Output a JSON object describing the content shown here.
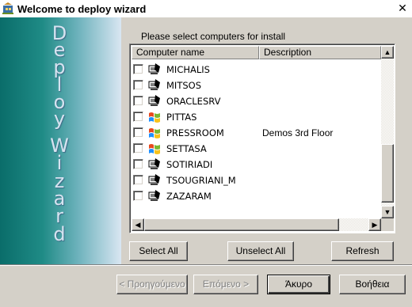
{
  "window": {
    "title": "Welcome to deploy wizard",
    "close_glyph": "✕"
  },
  "banner": {
    "letters": [
      "D",
      "e",
      "p",
      "l",
      "o",
      "y",
      "W",
      "i",
      "z",
      "a",
      "r",
      "d"
    ]
  },
  "panel": {
    "label": "Please select computers for install"
  },
  "listview": {
    "columns": [
      "Computer name",
      "Description"
    ],
    "rows": [
      {
        "name": "MICHALIS",
        "description": "",
        "icon": "computer-icon"
      },
      {
        "name": "MITSOS",
        "description": "",
        "icon": "computer-icon"
      },
      {
        "name": "ORACLESRV",
        "description": "",
        "icon": "computer-icon"
      },
      {
        "name": "PITTAS",
        "description": "",
        "icon": "windows-logo-icon"
      },
      {
        "name": "PRESSROOM",
        "description": "Demos 3rd Floor",
        "icon": "windows-logo-icon"
      },
      {
        "name": "SETTASA",
        "description": "",
        "icon": "windows-logo-icon"
      },
      {
        "name": "SOTIRIADI",
        "description": "",
        "icon": "computer-icon"
      },
      {
        "name": "TSOUGRIANI_M",
        "description": "",
        "icon": "computer-icon"
      },
      {
        "name": "ZAZARAM",
        "description": "",
        "icon": "computer-icon"
      }
    ]
  },
  "actions": {
    "select_all": "Select All",
    "unselect_all": "Unselect All",
    "refresh": "Refresh"
  },
  "footer": {
    "back": "< Προηγούμενο",
    "next": "Επόμενο >",
    "cancel": "Άκυρο",
    "help": "Βοήθεια"
  },
  "colors": {
    "dialog_face": "#d4d0c8",
    "banner_dark": "#0a6d6a",
    "banner_light": "#d9e6f2"
  }
}
